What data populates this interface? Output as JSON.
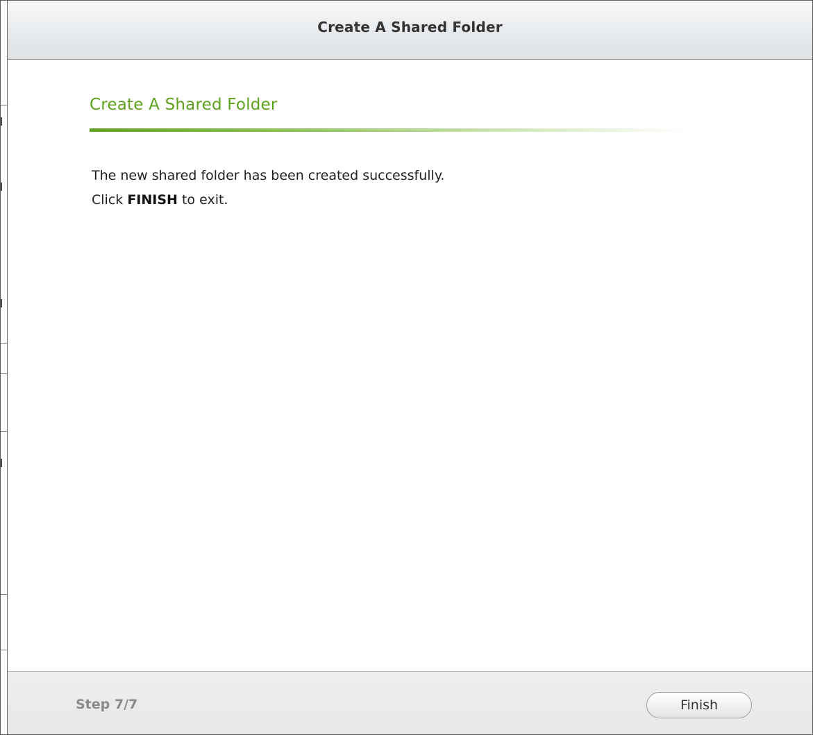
{
  "dialog": {
    "title": "Create A Shared Folder"
  },
  "content": {
    "heading": "Create A Shared Folder",
    "message_line1": "The new shared folder has been created successfully.",
    "message_line2_prefix": "Click ",
    "message_line2_bold": "FINISH",
    "message_line2_suffix": " to exit."
  },
  "footer": {
    "step_label": "Step 7/7",
    "finish_label": "Finish"
  },
  "colors": {
    "heading_green": "#5ea11e",
    "titlebar_bg": "#e6e9ec",
    "footer_bg": "#eeeeee",
    "step_text": "#8a8a8a"
  }
}
